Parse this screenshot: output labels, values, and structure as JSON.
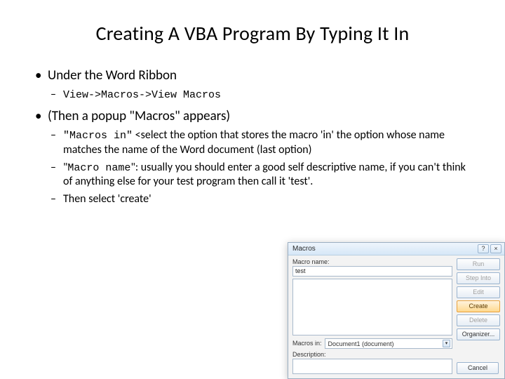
{
  "title": "Creating A VBA Program By Typing It In",
  "bullets": {
    "b1": "Under the Word Ribbon",
    "b1_sub1": "View->Macros->View Macros",
    "b2": "(Then a popup \"Macros\" appears)",
    "b2_sub1_code": "\"Macros in\"",
    "b2_sub1_rest": " <select the option that stores the macro 'in' the option whose name matches the name of the Word document (last option)",
    "b2_sub2_code": "\"Macro name\"",
    "b2_sub2_rest": ": usually you should enter a good self descriptive name, if you can't think of anything else for your test program then call it 'test'.",
    "b2_sub3": "Then select 'create'"
  },
  "dialog": {
    "title": "Macros",
    "help_btn": "?",
    "close_btn": "×",
    "macro_name_label": "Macro name:",
    "macro_name_value": "test",
    "macros_in_label": "Macros in:",
    "macros_in_value": "Document1 (document)",
    "description_label": "Description:",
    "buttons": {
      "run": "Run",
      "step_into": "Step Into",
      "edit": "Edit",
      "create": "Create",
      "delete": "Delete",
      "organizer": "Organizer...",
      "cancel": "Cancel"
    }
  }
}
